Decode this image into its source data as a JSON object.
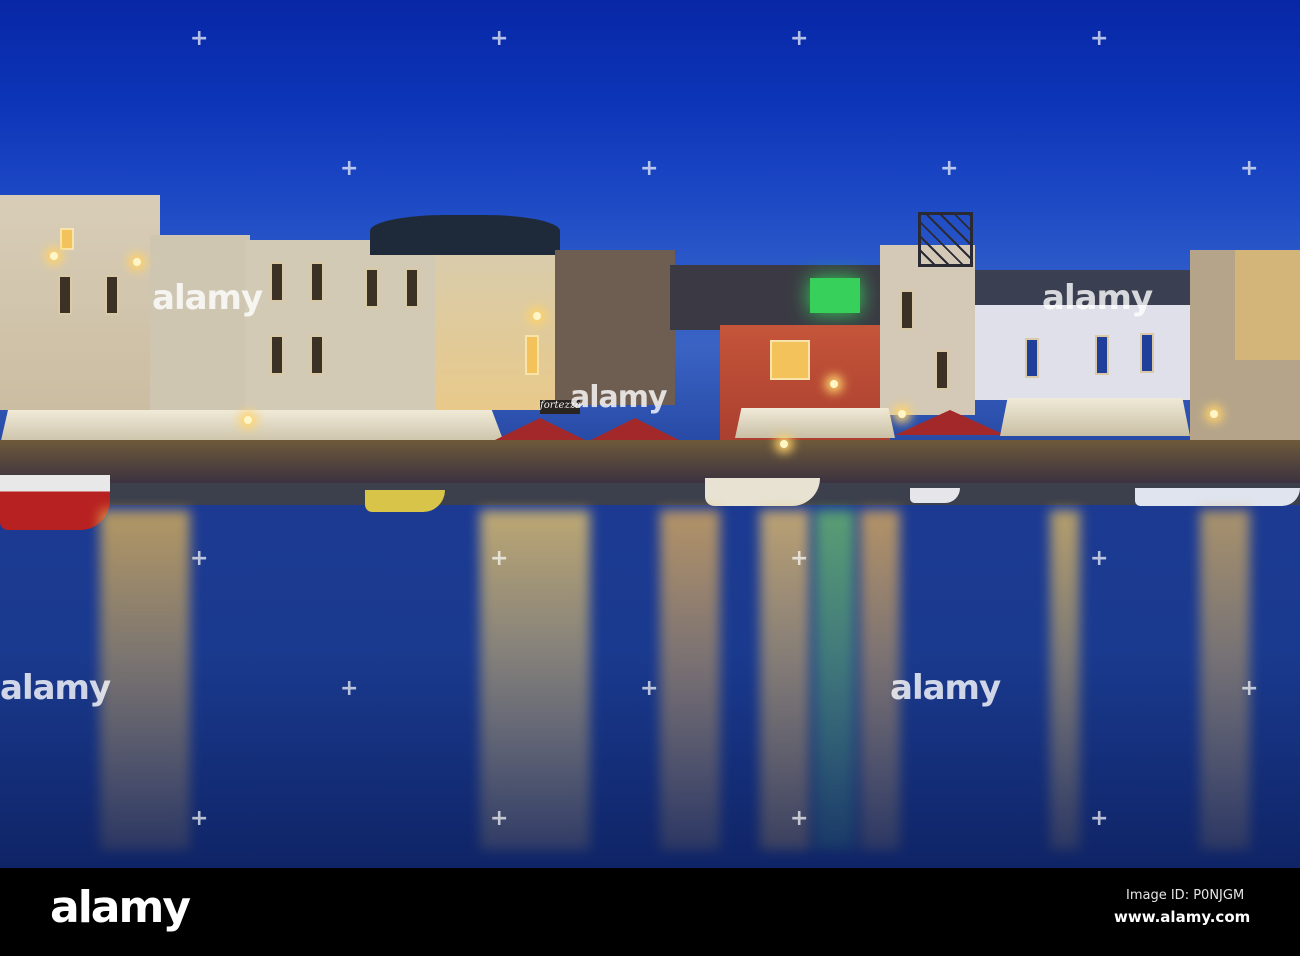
{
  "scene": {
    "description_tags": [
      "harbour",
      "night",
      "waterfront-buildings",
      "reflections"
    ],
    "signage": {
      "restaurant_sign": "fortezza"
    },
    "colors": {
      "sky": "#0d35b8",
      "water": "#1a3a8f",
      "lights": "#f3c25b",
      "red_building": "#b24a35",
      "green_light": "#36d05a"
    }
  },
  "watermark": {
    "text": "alamy"
  },
  "footer": {
    "logo": "alamy",
    "image_id": "Image ID: P0NJGM",
    "url": "www.alamy.com"
  }
}
